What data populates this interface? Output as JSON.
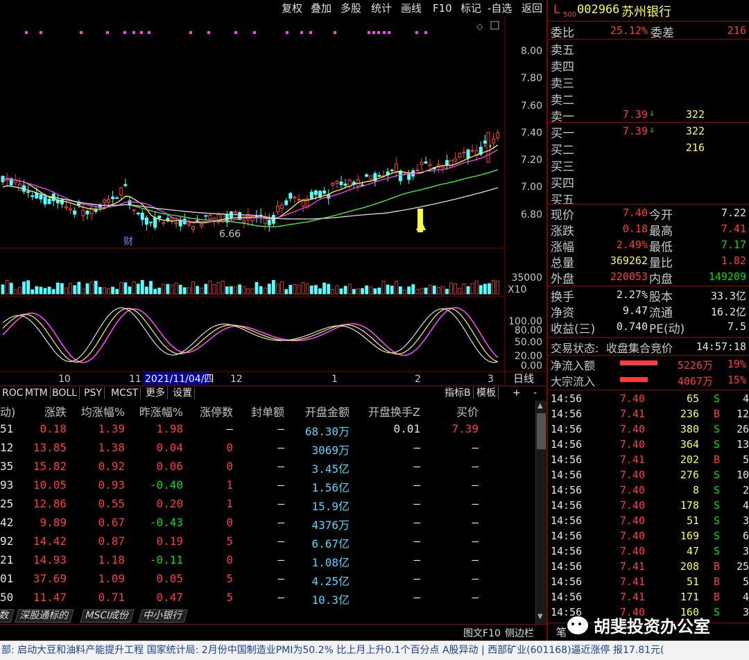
{
  "toolbar": {
    "items": [
      "复权",
      "叠加",
      "多股",
      "统计",
      "画线",
      "F10",
      "标记",
      "-自选",
      "返回"
    ]
  },
  "chart": {
    "price_axis": [
      "8.00",
      "7.80",
      "7.60",
      "7.40",
      "7.20",
      "7.00",
      "6.80"
    ],
    "low_label": "6.66",
    "fin_mark": "财",
    "vol_axis": "35000",
    "vol_unit": "X10",
    "osc_axis": [
      "100.00",
      "80.00",
      "50.00",
      "20.00",
      "0.00"
    ],
    "date_axis": [
      "10",
      "11",
      "12",
      "1",
      "2",
      "3"
    ],
    "cursor_date": "2021/11/04/四",
    "period": "日线"
  },
  "indicator_tabs": [
    "ROC",
    "MTM",
    "BOLL",
    "PSY",
    "MCST",
    "更多",
    "设置"
  ],
  "indicator_right": {
    "a": "指标B",
    "b": "模板",
    "c": "+",
    "d": "-"
  },
  "table": {
    "headers": [
      "动)",
      "涨跌",
      "均涨幅%",
      "昨涨幅%",
      "涨停数",
      "封单额",
      "开盘金额",
      "开盘换手Z",
      "买价"
    ],
    "rows": [
      [
        "51",
        "0.18",
        "1.39",
        "1.98",
        "—",
        "—",
        "68.30万",
        "0.01",
        "7.39"
      ],
      [
        "12",
        "13.85",
        "1.38",
        "0.04",
        "0",
        "—",
        "3069万",
        "—",
        "—"
      ],
      [
        "35",
        "15.82",
        "0.92",
        "0.06",
        "0",
        "—",
        "3.45亿",
        "—",
        "—"
      ],
      [
        "93",
        "10.05",
        "0.93",
        "-0.40",
        "1",
        "—",
        "1.56亿",
        "—",
        "—"
      ],
      [
        "25",
        "12.86",
        "0.55",
        "0.20",
        "1",
        "—",
        "15.9亿",
        "—",
        "—"
      ],
      [
        "42",
        "9.89",
        "0.67",
        "-0.43",
        "0",
        "—",
        "4376万",
        "—",
        "—"
      ],
      [
        "92",
        "14.42",
        "0.87",
        "0.19",
        "5",
        "—",
        "6.67亿",
        "—",
        "—"
      ],
      [
        "21",
        "14.93",
        "1.18",
        "-0.11",
        "0",
        "—",
        "1.08亿",
        "—",
        "—"
      ],
      [
        "01",
        "37.69",
        "1.09",
        "0.05",
        "5",
        "—",
        "4.25亿",
        "—",
        "—"
      ],
      [
        "50",
        "11.47",
        "0.71",
        "0.47",
        "5",
        "—",
        "10.3亿",
        "—",
        "—"
      ]
    ]
  },
  "bottom_tabs": [
    "数",
    "深股通标的",
    "MSCI成份",
    "中小银行"
  ],
  "bottom_right": {
    "a": "图文F10",
    "b": "侧边栏"
  },
  "ticker": "部: 启动大豆和油料产能提升工程      国家统计局: 2月份中国制造业PMI为50.2% 比上月上升0.1个百分点      A股异动 | 西部矿业(601168)逼近涨停 报17.81元(",
  "right": {
    "prefix": "L",
    "sub": "500",
    "code": "002966",
    "name": "苏州银行",
    "weibi_label": "委比",
    "weibi": "25.12%",
    "weicha_label": "委差",
    "weicha": "216",
    "sell": [
      {
        "label": "卖五",
        "price": "",
        "vol": ""
      },
      {
        "label": "卖四",
        "price": "",
        "vol": ""
      },
      {
        "label": "卖三",
        "price": "",
        "vol": ""
      },
      {
        "label": "卖二",
        "price": "",
        "vol": ""
      },
      {
        "label": "卖一",
        "price": "7.39",
        "vol": "322"
      }
    ],
    "buy": [
      {
        "label": "买一",
        "price": "7.39",
        "vol": "322"
      },
      {
        "label": "买二",
        "price": "",
        "vol": "216"
      },
      {
        "label": "买三",
        "price": "",
        "vol": ""
      },
      {
        "label": "买四",
        "price": "",
        "vol": ""
      },
      {
        "label": "买五",
        "price": "",
        "vol": ""
      }
    ],
    "quote": [
      [
        "现价",
        "7.40",
        "今开",
        "7.22"
      ],
      [
        "涨跌",
        "0.18",
        "最高",
        "7.41"
      ],
      [
        "涨幅",
        "2.49%",
        "最低",
        "7.17"
      ],
      [
        "总量",
        "369262",
        "量比",
        "1.82"
      ],
      [
        "外盘",
        "220053",
        "内盘",
        "149209"
      ]
    ],
    "stats": [
      [
        "换手",
        "2.27%",
        "股本",
        "33.3亿"
      ],
      [
        "净资",
        "9.47",
        "流通",
        "16.2亿"
      ],
      [
        "收益(三)",
        "0.740",
        "PE(动)",
        "7.5"
      ]
    ],
    "status_label": "交易状态:",
    "status": "收盘集合竞价",
    "status_time": "14:57:18",
    "netin_label": "净流入额",
    "netin": "5226万",
    "netin_pct": "19%",
    "bulk_label": "大宗流入",
    "bulk": "4067万",
    "bulk_pct": "15%",
    "ticks": [
      [
        "14:56",
        "7.40",
        "65",
        "S",
        "4"
      ],
      [
        "14:56",
        "7.41",
        "236",
        "B",
        "12"
      ],
      [
        "14:56",
        "7.40",
        "380",
        "S",
        "26"
      ],
      [
        "14:56",
        "7.40",
        "364",
        "S",
        "13"
      ],
      [
        "14:56",
        "7.41",
        "202",
        "B",
        "5"
      ],
      [
        "14:56",
        "7.40",
        "276",
        "S",
        "10"
      ],
      [
        "14:56",
        "7.40",
        "8",
        "S",
        "2"
      ],
      [
        "14:56",
        "7.40",
        "178",
        "S",
        "4"
      ],
      [
        "14:56",
        "7.40",
        "51",
        "S",
        "3"
      ],
      [
        "14:56",
        "7.40",
        "169",
        "S",
        "6"
      ],
      [
        "14:56",
        "7.40",
        "47",
        "S",
        "3"
      ],
      [
        "14:56",
        "7.41",
        "208",
        "B",
        "25"
      ],
      [
        "14:56",
        "7.41",
        "51",
        "B",
        "5"
      ],
      [
        "14:56",
        "7.41",
        "171",
        "B",
        "4"
      ],
      [
        "14:56",
        "7.40",
        "160",
        "S",
        "3"
      ]
    ],
    "bottom_tab": "笔",
    "watermark": "胡斐投资办公室"
  }
}
